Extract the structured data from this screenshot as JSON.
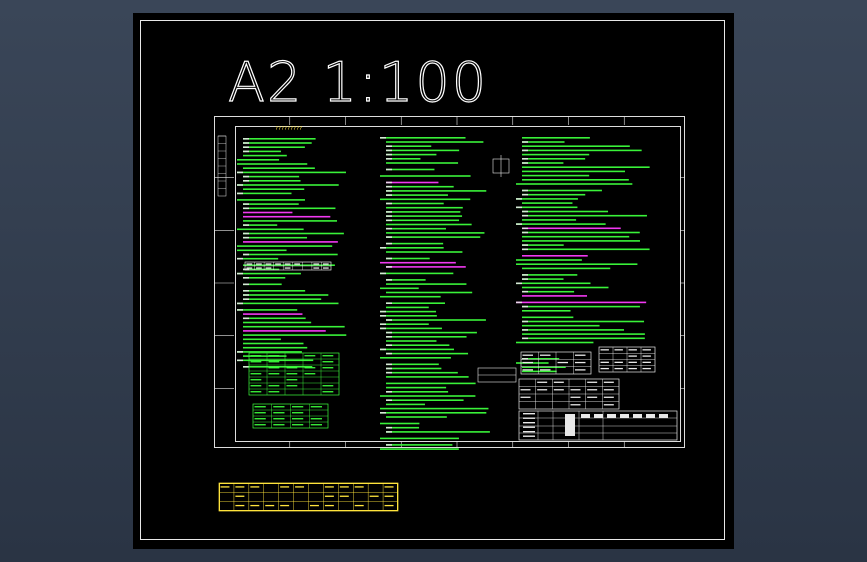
{
  "drawing": {
    "scale_label": "A2 1:100",
    "sheet_title": "?????????",
    "colors": {
      "background": "#000000",
      "frame": "#e8e8e8",
      "note_text": "#3cff3c",
      "highlight_text": "#ff3cff",
      "title_text": "#ffe43c",
      "table_lines": "#3cff3c",
      "bottom_table_lines": "#ffe43c"
    }
  }
}
